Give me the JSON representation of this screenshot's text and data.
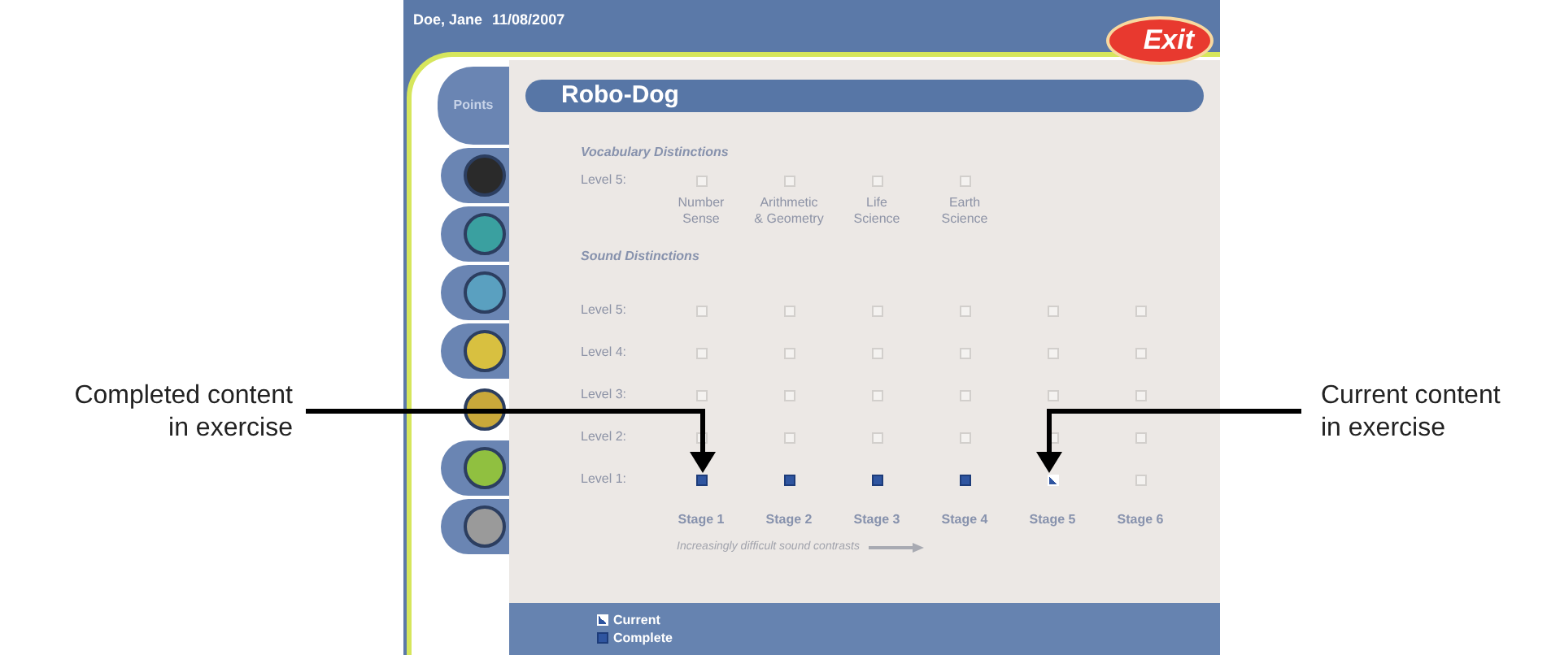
{
  "header": {
    "user": "Doe, Jane",
    "date": "11/08/2007"
  },
  "exit_button": "Exit",
  "sidebar": {
    "points_label": "Points",
    "items": [
      {
        "selected": false
      },
      {
        "selected": false
      },
      {
        "selected": false
      },
      {
        "selected": false
      },
      {
        "selected": true
      },
      {
        "selected": false
      },
      {
        "selected": false
      }
    ]
  },
  "title": "Robo-Dog",
  "vocabulary": {
    "heading": "Vocabulary Distinctions",
    "rows": [
      {
        "label": "Level 5:",
        "cells": [
          {
            "kind": "empty"
          },
          {
            "kind": "empty"
          },
          {
            "kind": "empty"
          },
          {
            "kind": "empty"
          }
        ]
      }
    ],
    "columns": [
      "Number\nSense",
      "Arithmetic\n& Geometry",
      "Life\nScience",
      "Earth\nScience"
    ]
  },
  "sound": {
    "heading": "Sound Distinctions",
    "rows": [
      {
        "label": "Level 5:",
        "cells": [
          {
            "kind": "empty"
          },
          {
            "kind": "empty"
          },
          {
            "kind": "empty"
          },
          {
            "kind": "empty"
          },
          {
            "kind": "empty"
          },
          {
            "kind": "empty"
          }
        ]
      },
      {
        "label": "Level 4:",
        "cells": [
          {
            "kind": "empty"
          },
          {
            "kind": "empty"
          },
          {
            "kind": "empty"
          },
          {
            "kind": "empty"
          },
          {
            "kind": "empty"
          },
          {
            "kind": "empty"
          }
        ]
      },
      {
        "label": "Level 3:",
        "cells": [
          {
            "kind": "empty"
          },
          {
            "kind": "empty"
          },
          {
            "kind": "empty"
          },
          {
            "kind": "empty"
          },
          {
            "kind": "empty"
          },
          {
            "kind": "empty"
          }
        ]
      },
      {
        "label": "Level 2:",
        "cells": [
          {
            "kind": "empty"
          },
          {
            "kind": "empty"
          },
          {
            "kind": "empty"
          },
          {
            "kind": "empty"
          },
          {
            "kind": "empty"
          },
          {
            "kind": "empty"
          }
        ]
      },
      {
        "label": "Level 1:",
        "cells": [
          {
            "kind": "complete"
          },
          {
            "kind": "complete"
          },
          {
            "kind": "complete"
          },
          {
            "kind": "complete"
          },
          {
            "kind": "current"
          },
          {
            "kind": "empty"
          }
        ]
      }
    ],
    "stages": [
      "Stage 1",
      "Stage 2",
      "Stage 3",
      "Stage 4",
      "Stage 5",
      "Stage 6"
    ],
    "caption": "Increasingly difficult sound contrasts"
  },
  "legend": [
    {
      "kind": "current",
      "label": "Current"
    },
    {
      "kind": "complete",
      "label": "Complete"
    }
  ],
  "left_callout": {
    "lines": [
      "Completed content",
      "in exercise"
    ]
  },
  "right_callout": {
    "lines": [
      "Current content",
      "in exercise"
    ]
  }
}
